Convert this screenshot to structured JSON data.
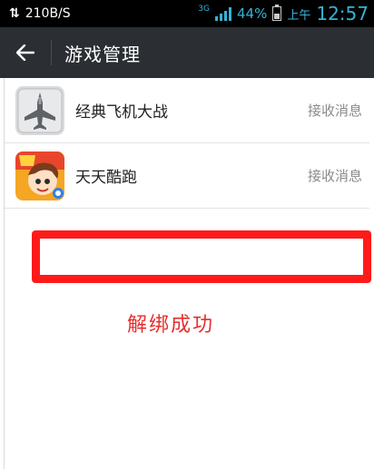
{
  "status_bar": {
    "net_speed": "210B/S",
    "network_type": "3G",
    "battery_percent": "44%",
    "ampm": "上午",
    "time": "12:57"
  },
  "action_bar": {
    "back_icon": "arrow-left-icon",
    "title": "游戏管理"
  },
  "games": [
    {
      "name": "经典飞机大战",
      "action": "接收消息",
      "icon": "fighter-jet-icon"
    },
    {
      "name": "天天酷跑",
      "action": "接收消息",
      "icon": "parkour-game-icon"
    }
  ],
  "annotation": {
    "message": "解绑成功",
    "color": "#ff1a1a"
  }
}
